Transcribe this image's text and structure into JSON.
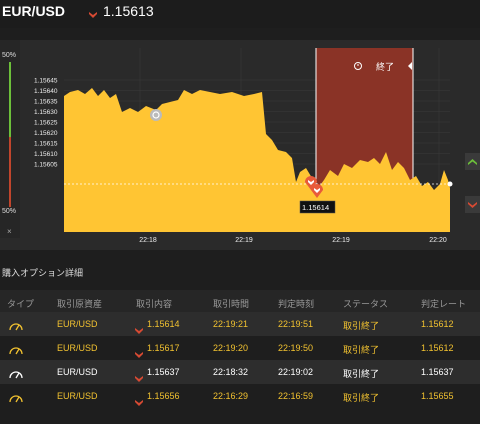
{
  "header": {
    "pair": "EUR/USD",
    "rate": "1.15613",
    "direction": "down"
  },
  "gauge": {
    "top_pct": "50%",
    "bottom_pct": "50%",
    "close": "×"
  },
  "chart": {
    "y_ticks": [
      "1.15645",
      "1.15640",
      "1.15635",
      "1.15630",
      "1.15625",
      "1.15620",
      "1.15615",
      "1.15610",
      "1.15605"
    ],
    "x_ticks": [
      "22:18",
      "22:19",
      "22:19",
      "22:20"
    ],
    "end_label": "終了",
    "price_tag": "1.15614",
    "colors": {
      "area": "#ffc533",
      "expiry": "#8a3326",
      "up": "#6cbf3a",
      "down": "#d84a33"
    }
  },
  "section": {
    "title": "購入オプション詳細"
  },
  "table": {
    "headers": [
      "タイプ",
      "取引原資産",
      "取引内容",
      "取引時間",
      "判定時刻",
      "ステータス",
      "判定レート"
    ],
    "rows": [
      {
        "asset": "EUR/USD",
        "direction": "down",
        "entry": "1.15614",
        "trade_time": "22:19:21",
        "judge_time": "22:19:51",
        "status": "取引終了",
        "judge_rate": "1.15612",
        "style": "yellow",
        "bg": "light"
      },
      {
        "asset": "EUR/USD",
        "direction": "down",
        "entry": "1.15617",
        "trade_time": "22:19:20",
        "judge_time": "22:19:50",
        "status": "取引終了",
        "judge_rate": "1.15612",
        "style": "yellow",
        "bg": "dark"
      },
      {
        "asset": "EUR/USD",
        "direction": "down",
        "entry": "1.15637",
        "trade_time": "22:18:32",
        "judge_time": "22:19:02",
        "status": "取引終了",
        "judge_rate": "1.15637",
        "style": "white",
        "bg": "light"
      },
      {
        "asset": "EUR/USD",
        "direction": "down",
        "entry": "1.15656",
        "trade_time": "22:16:29",
        "judge_time": "22:16:59",
        "status": "取引終了",
        "judge_rate": "1.15655",
        "style": "yellow",
        "bg": "dark"
      }
    ]
  }
}
